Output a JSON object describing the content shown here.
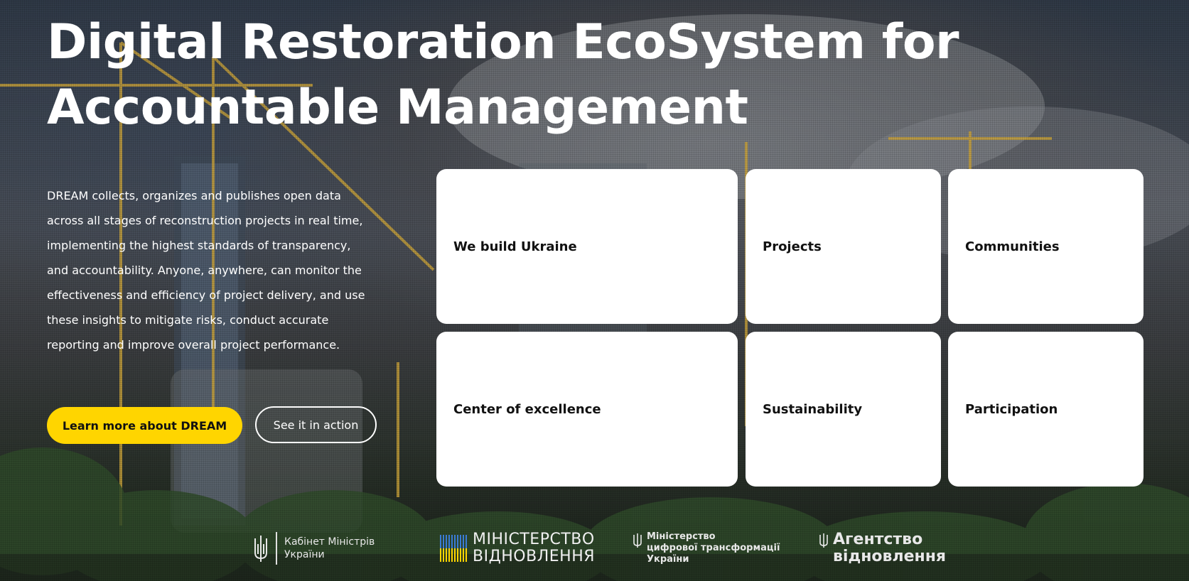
{
  "hero": {
    "title": "Digital Restoration EcoSystem for Accountable Management",
    "description": "DREAM collects, organizes and publishes open data across all stages of reconstruction projects in real time, implementing the highest standards of transparency, and accountability. Anyone, anywhere, can monitor the effectiveness and efficiency of project delivery, and use these insights to mitigate risks, conduct accurate reporting and improve overall project performance.",
    "primary_button": "Learn more about DREAM",
    "secondary_button": "See it in action"
  },
  "cards": [
    {
      "label": "We build Ukraine"
    },
    {
      "label": "Projects"
    },
    {
      "label": "Communities"
    },
    {
      "label": "Center of excellence"
    },
    {
      "label": "Sustainability"
    },
    {
      "label": "Participation"
    }
  ],
  "partners": [
    {
      "lines": [
        "Кабінет Міністрів",
        "України"
      ],
      "icon": "trident-icon"
    },
    {
      "lines": [
        "МІНІСТЕРСТВО",
        "ВІДНОВЛЕННЯ"
      ],
      "icon": "flag-pattern-icon"
    },
    {
      "lines": [
        "Міністерство",
        "цифрової трансформації",
        "України"
      ],
      "icon": "trident-icon"
    },
    {
      "lines": [
        "Агентство",
        "відновлення"
      ],
      "icon": "trident-icon"
    }
  ],
  "colors": {
    "accent": "#ffd500",
    "card_bg": "#ffffff",
    "card_text": "#111111"
  }
}
